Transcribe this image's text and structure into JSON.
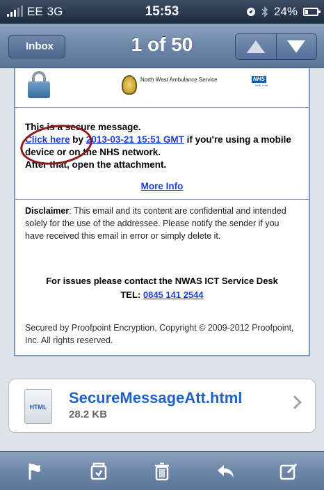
{
  "status_bar": {
    "carrier": "EE",
    "network": "3G",
    "time": "15:53",
    "battery": "24%",
    "battery_level": 0.24
  },
  "nav": {
    "back_label": "Inbox",
    "title": "1 of 50"
  },
  "message": {
    "org_name": "North West Ambulance Service",
    "nhs_label": "NHS",
    "nhs_sub": "NHS Trust",
    "secure_heading": "This is a secure message.",
    "click_here": "Click here",
    "by_text": " by ",
    "deadline": "2013-03-21 15:51 GMT",
    "device_text": " if you're using a mobile device or on the NHS network.",
    "after_text": "After that, open the attachment.",
    "more_info": "More Info",
    "disclaimer_label": "Disclaimer",
    "disclaimer_text": ": This email and its content are confidential and intended solely for the use of the addressee. Please notify the sender if you have received this email in error or simply delete it.",
    "issues_line": "For issues please contact the NWAS ICT Service Desk",
    "tel_label": "TEL: ",
    "tel_number": "0845 141 2544",
    "secured_by": "Secured by Proofpoint Encryption, Copyright © 2009-2012 Proofpoint, Inc. All rights reserved."
  },
  "attachment": {
    "type_label": "HTML",
    "file_name": "SecureMessageAtt.html",
    "file_size": "28.2 KB"
  },
  "toolbar": {
    "icons": [
      "flag-icon",
      "move-folder-icon",
      "trash-icon",
      "reply-icon",
      "compose-icon"
    ]
  },
  "colors": {
    "link": "#1a3fd6",
    "annotation_circle": "#8b1a1a",
    "nav_bar": "#6d86a8",
    "attachment_name": "#1f63c9"
  }
}
